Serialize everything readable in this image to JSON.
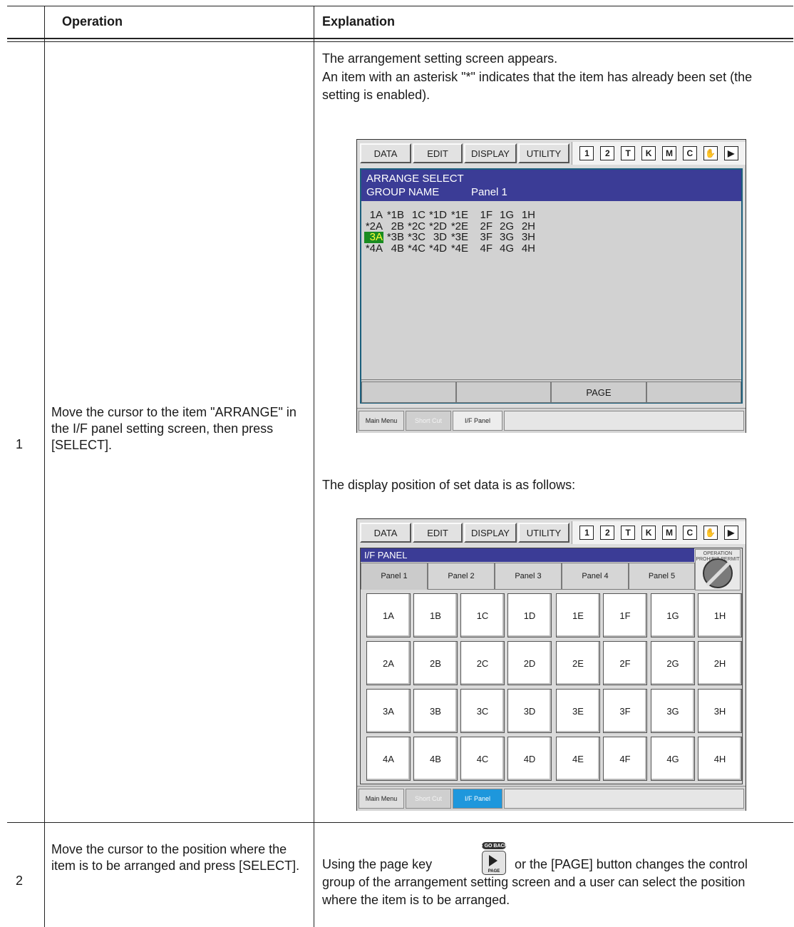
{
  "table": {
    "headers": {
      "operation": "Operation",
      "explanation": "Explanation"
    },
    "steps": [
      {
        "num": "1",
        "operation": "Move the cursor to the item \"ARRANGE\" in the I/F panel setting screen, then press [SELECT].",
        "explanation_1": "The arrangement setting screen appears.",
        "explanation_2": "An item with an asterisk \"*\" indicates that the item has already been set (the setting is enabled).",
        "explanation_3": "The display position of set data is as follows:"
      },
      {
        "num": "2",
        "operation": "Move the cursor to the position where the item is to be arranged and press [SELECT].",
        "explanation_pre": "Using the page key",
        "explanation_post": "or the [PAGE] button changes the control group of the arrangement setting screen and a user can select the position where the item is to be arranged."
      }
    ]
  },
  "pendant": {
    "menu": [
      "DATA",
      "EDIT",
      "DISPLAY",
      "UTILITY"
    ],
    "status_icons": [
      "coordinate-icon",
      "step-icon",
      "tool-icon",
      "security-icon",
      "mode-icon",
      "cycle-icon",
      "hand-icon",
      "play-icon"
    ],
    "bottom": {
      "main_menu": "Main Menu",
      "short_cut": "Short Cut",
      "if_panel": "I/F Panel"
    }
  },
  "arrange_screen": {
    "title": "ARRANGE SELECT",
    "group_label": "GROUP NAME",
    "group_value": "Panel 1",
    "rows": [
      [
        "1A",
        "*1B",
        "1C",
        "*1D",
        "*1E",
        "1F",
        "1G",
        "1H"
      ],
      [
        "*2A",
        "2B",
        "*2C",
        "*2D",
        "*2E",
        "2F",
        "2G",
        "2H"
      ],
      [
        "3A",
        "*3B",
        "*3C",
        "3D",
        "*3E",
        "3F",
        "3G",
        "3H"
      ],
      [
        "*4A",
        "4B",
        "*4C",
        "*4D",
        "*4E",
        "4F",
        "4G",
        "4H"
      ]
    ],
    "selected": "3A",
    "function_keys": [
      "",
      "",
      "PAGE",
      ""
    ]
  },
  "if_panel_screen": {
    "title": "I/F PANEL",
    "operation_label": "OPERATION PROHIBIT PERMIT",
    "tabs": [
      "Panel 1",
      "Panel 2",
      "Panel 3",
      "Panel 4",
      "Panel 5"
    ],
    "active_tab": "Panel 1",
    "grid": [
      [
        "1A",
        "1B",
        "1C",
        "1D",
        "1E",
        "1F",
        "1G",
        "1H"
      ],
      [
        "2A",
        "2B",
        "2C",
        "2D",
        "2E",
        "2F",
        "2G",
        "2H"
      ],
      [
        "3A",
        "3B",
        "3C",
        "3D",
        "3E",
        "3F",
        "3G",
        "3H"
      ],
      [
        "4A",
        "4B",
        "4C",
        "4D",
        "4E",
        "4F",
        "4G",
        "4H"
      ]
    ]
  },
  "page_key": {
    "top_label": "● GO BACK",
    "label": "PAGE"
  },
  "colors": {
    "title_bar": "#3b3c96",
    "selection_bg": "#1a8c21",
    "selection_text": "#ffff3a",
    "active_tab": "#1e97dc"
  }
}
